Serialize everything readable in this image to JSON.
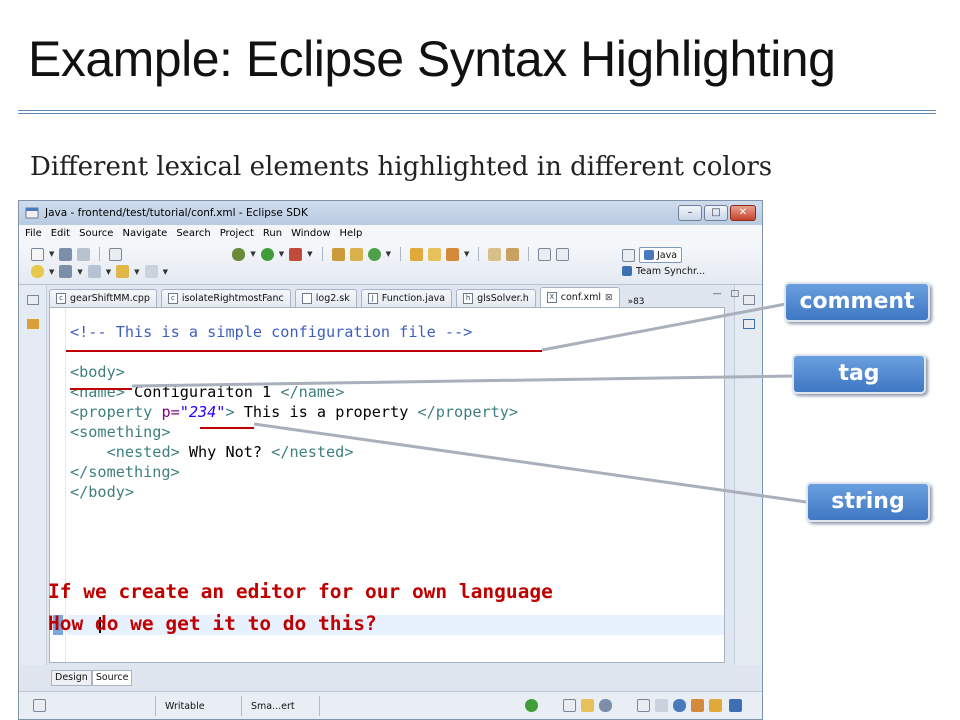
{
  "slide": {
    "title": "Example: Eclipse Syntax Highlighting",
    "subtitle": "Different lexical elements highlighted in different colors"
  },
  "window": {
    "title": "Java - frontend/test/tutorial/conf.xml - Eclipse SDK",
    "controls": {
      "minimize": "–",
      "maximize": "□",
      "close": "✕"
    }
  },
  "menu": [
    "File",
    "Edit",
    "Source",
    "Navigate",
    "Search",
    "Project",
    "Run",
    "Window",
    "Help"
  ],
  "perspectives": {
    "java": "Java",
    "team": "Team Synchr..."
  },
  "tabs": [
    {
      "label": "gearShiftMM.cpp",
      "icon": "c"
    },
    {
      "label": "isolateRightmostFanc",
      "icon": "c"
    },
    {
      "label": "log2.sk",
      "icon": ""
    },
    {
      "label": "Function.java",
      "icon": "J"
    },
    {
      "label": "glsSolver.h",
      "icon": "h"
    },
    {
      "label": "conf.xml",
      "icon": "X",
      "active": true
    }
  ],
  "tab_overflow": "»83",
  "code": {
    "line1": {
      "comment": "<!-- This is a simple configuration file -->"
    },
    "line2": {
      "tag": "<body>"
    },
    "line3": {
      "open": "<name>",
      "text": " Configuraiton 1 ",
      "close": "</name>"
    },
    "line4": {
      "open": "<property",
      "attr": " p=",
      "value": "\"234\"",
      "gt": ">",
      "text": " This is a property ",
      "close": "</property>"
    },
    "line5": {
      "tag": "<something>"
    },
    "line6": {
      "indent": "    ",
      "open": "<nested>",
      "text": " Why Not? ",
      "close": "</nested>"
    },
    "line7": {
      "tag": "</something>"
    },
    "line8": {
      "tag": "</body>"
    }
  },
  "question": {
    "line1": "If we create an editor for our own language",
    "line2": "How do we get it to do this?"
  },
  "bottom_tabs": {
    "design": "Design",
    "source": "Source"
  },
  "status": {
    "writable": "Writable",
    "mode": "Sma...ert"
  },
  "callouts": {
    "comment": "comment",
    "tag": "tag",
    "string": "string"
  },
  "colors": {
    "comment": "#3f5fbf",
    "tag": "#3f7f7f",
    "attribute": "#7f007f",
    "string": "#2a00ff",
    "question": "#c00000",
    "callout": "#4f86cf"
  }
}
